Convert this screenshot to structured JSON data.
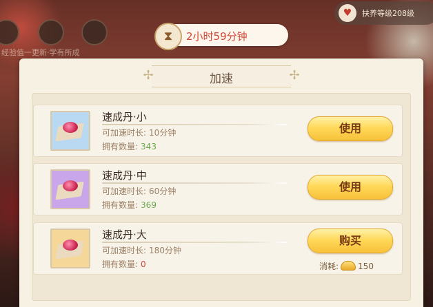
{
  "background": {
    "top_right_label": "扶养等级208级",
    "left_caption": "经验值一更新·学有所成"
  },
  "timer": {
    "icon": "hourglass-icon",
    "text": "2小时59分钟"
  },
  "panel": {
    "title": "加速",
    "items": [
      {
        "name": "速成丹·小",
        "duration_label": "可加速时长:",
        "duration_value": "10分钟",
        "count_label": "拥有数量:",
        "count_value": "343",
        "action_label": "使用",
        "thumb_color": "#b9d9f2"
      },
      {
        "name": "速成丹·中",
        "duration_label": "可加速时长:",
        "duration_value": "60分钟",
        "count_label": "拥有数量:",
        "count_value": "369",
        "action_label": "使用",
        "thumb_color": "#c9a6ea"
      },
      {
        "name": "速成丹·大",
        "duration_label": "可加速时长:",
        "duration_value": "180分钟",
        "count_label": "拥有数量:",
        "count_value": "0",
        "action_label": "购买",
        "cost_label": "消耗:",
        "cost_value": "150",
        "thumb_color": "#f5d79a"
      }
    ]
  },
  "colors": {
    "count_positive": "#6aa84f",
    "count_zero": "#d0453a",
    "timer_text": "#d44535"
  }
}
